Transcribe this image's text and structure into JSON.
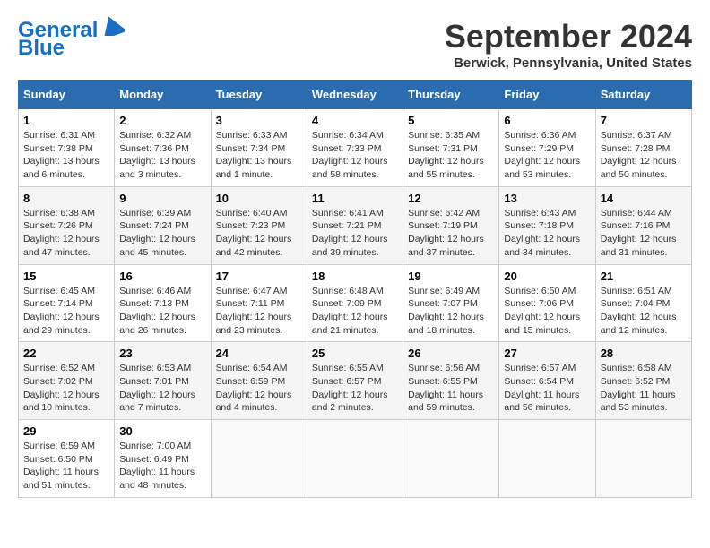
{
  "header": {
    "logo_line1": "General",
    "logo_line2": "Blue",
    "month_title": "September 2024",
    "location": "Berwick, Pennsylvania, United States"
  },
  "days_of_week": [
    "Sunday",
    "Monday",
    "Tuesday",
    "Wednesday",
    "Thursday",
    "Friday",
    "Saturday"
  ],
  "weeks": [
    [
      {
        "day": "1",
        "sunrise": "6:31 AM",
        "sunset": "7:38 PM",
        "daylight": "13 hours and 6 minutes."
      },
      {
        "day": "2",
        "sunrise": "6:32 AM",
        "sunset": "7:36 PM",
        "daylight": "13 hours and 3 minutes."
      },
      {
        "day": "3",
        "sunrise": "6:33 AM",
        "sunset": "7:34 PM",
        "daylight": "13 hours and 1 minute."
      },
      {
        "day": "4",
        "sunrise": "6:34 AM",
        "sunset": "7:33 PM",
        "daylight": "12 hours and 58 minutes."
      },
      {
        "day": "5",
        "sunrise": "6:35 AM",
        "sunset": "7:31 PM",
        "daylight": "12 hours and 55 minutes."
      },
      {
        "day": "6",
        "sunrise": "6:36 AM",
        "sunset": "7:29 PM",
        "daylight": "12 hours and 53 minutes."
      },
      {
        "day": "7",
        "sunrise": "6:37 AM",
        "sunset": "7:28 PM",
        "daylight": "12 hours and 50 minutes."
      }
    ],
    [
      {
        "day": "8",
        "sunrise": "6:38 AM",
        "sunset": "7:26 PM",
        "daylight": "12 hours and 47 minutes."
      },
      {
        "day": "9",
        "sunrise": "6:39 AM",
        "sunset": "7:24 PM",
        "daylight": "12 hours and 45 minutes."
      },
      {
        "day": "10",
        "sunrise": "6:40 AM",
        "sunset": "7:23 PM",
        "daylight": "12 hours and 42 minutes."
      },
      {
        "day": "11",
        "sunrise": "6:41 AM",
        "sunset": "7:21 PM",
        "daylight": "12 hours and 39 minutes."
      },
      {
        "day": "12",
        "sunrise": "6:42 AM",
        "sunset": "7:19 PM",
        "daylight": "12 hours and 37 minutes."
      },
      {
        "day": "13",
        "sunrise": "6:43 AM",
        "sunset": "7:18 PM",
        "daylight": "12 hours and 34 minutes."
      },
      {
        "day": "14",
        "sunrise": "6:44 AM",
        "sunset": "7:16 PM",
        "daylight": "12 hours and 31 minutes."
      }
    ],
    [
      {
        "day": "15",
        "sunrise": "6:45 AM",
        "sunset": "7:14 PM",
        "daylight": "12 hours and 29 minutes."
      },
      {
        "day": "16",
        "sunrise": "6:46 AM",
        "sunset": "7:13 PM",
        "daylight": "12 hours and 26 minutes."
      },
      {
        "day": "17",
        "sunrise": "6:47 AM",
        "sunset": "7:11 PM",
        "daylight": "12 hours and 23 minutes."
      },
      {
        "day": "18",
        "sunrise": "6:48 AM",
        "sunset": "7:09 PM",
        "daylight": "12 hours and 21 minutes."
      },
      {
        "day": "19",
        "sunrise": "6:49 AM",
        "sunset": "7:07 PM",
        "daylight": "12 hours and 18 minutes."
      },
      {
        "day": "20",
        "sunrise": "6:50 AM",
        "sunset": "7:06 PM",
        "daylight": "12 hours and 15 minutes."
      },
      {
        "day": "21",
        "sunrise": "6:51 AM",
        "sunset": "7:04 PM",
        "daylight": "12 hours and 12 minutes."
      }
    ],
    [
      {
        "day": "22",
        "sunrise": "6:52 AM",
        "sunset": "7:02 PM",
        "daylight": "12 hours and 10 minutes."
      },
      {
        "day": "23",
        "sunrise": "6:53 AM",
        "sunset": "7:01 PM",
        "daylight": "12 hours and 7 minutes."
      },
      {
        "day": "24",
        "sunrise": "6:54 AM",
        "sunset": "6:59 PM",
        "daylight": "12 hours and 4 minutes."
      },
      {
        "day": "25",
        "sunrise": "6:55 AM",
        "sunset": "6:57 PM",
        "daylight": "12 hours and 2 minutes."
      },
      {
        "day": "26",
        "sunrise": "6:56 AM",
        "sunset": "6:55 PM",
        "daylight": "11 hours and 59 minutes."
      },
      {
        "day": "27",
        "sunrise": "6:57 AM",
        "sunset": "6:54 PM",
        "daylight": "11 hours and 56 minutes."
      },
      {
        "day": "28",
        "sunrise": "6:58 AM",
        "sunset": "6:52 PM",
        "daylight": "11 hours and 53 minutes."
      }
    ],
    [
      {
        "day": "29",
        "sunrise": "6:59 AM",
        "sunset": "6:50 PM",
        "daylight": "11 hours and 51 minutes."
      },
      {
        "day": "30",
        "sunrise": "7:00 AM",
        "sunset": "6:49 PM",
        "daylight": "11 hours and 48 minutes."
      },
      {
        "day": "",
        "sunrise": "",
        "sunset": "",
        "daylight": ""
      },
      {
        "day": "",
        "sunrise": "",
        "sunset": "",
        "daylight": ""
      },
      {
        "day": "",
        "sunrise": "",
        "sunset": "",
        "daylight": ""
      },
      {
        "day": "",
        "sunrise": "",
        "sunset": "",
        "daylight": ""
      },
      {
        "day": "",
        "sunrise": "",
        "sunset": "",
        "daylight": ""
      }
    ]
  ]
}
